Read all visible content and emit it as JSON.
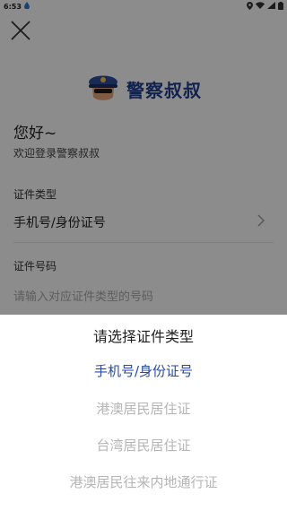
{
  "status_bar": {
    "time": "6:53"
  },
  "logo": {
    "app_name": "警察叔叔"
  },
  "greeting": "您好~",
  "welcome": "欢迎登录警察叔叔",
  "id_type": {
    "label": "证件类型",
    "value": "手机号/身份证号"
  },
  "id_number": {
    "label": "证件号码",
    "placeholder": "请输入对应证件类型的号码"
  },
  "picker": {
    "title": "请选择证件类型",
    "options": [
      {
        "label": "手机号/身份证号",
        "selected": true
      },
      {
        "label": "港澳居民居住证",
        "selected": false
      },
      {
        "label": "台湾居民居住证",
        "selected": false
      },
      {
        "label": "港澳居民往来内地通行证",
        "selected": false
      }
    ]
  },
  "colors": {
    "accent": "#2a4aa6",
    "brand": "#1f3f8f"
  }
}
